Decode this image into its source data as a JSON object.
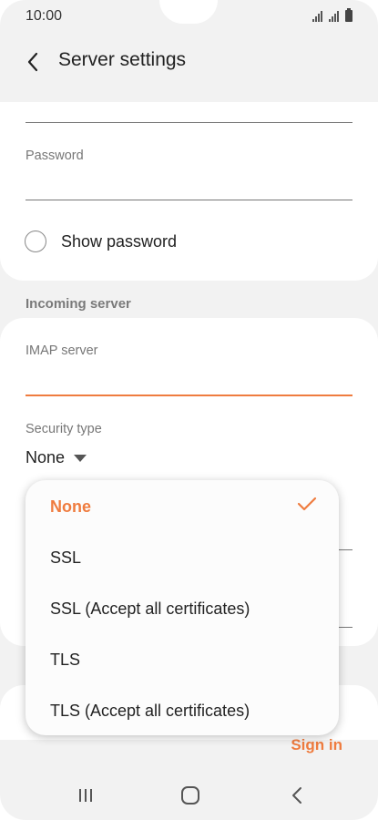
{
  "status_bar": {
    "time": "10:00"
  },
  "app_bar": {
    "title": "Server settings"
  },
  "account": {
    "password_label": "Password",
    "show_password_label": "Show password"
  },
  "incoming_server": {
    "section_title": "Incoming server",
    "imap_server_label": "IMAP server",
    "security_type_label": "Security type",
    "security_type_value": "None"
  },
  "security_dropdown": {
    "options": [
      {
        "label": "None",
        "selected": true
      },
      {
        "label": "SSL",
        "selected": false
      },
      {
        "label": "SSL (Accept all certificates)",
        "selected": false
      },
      {
        "label": "TLS",
        "selected": false
      },
      {
        "label": "TLS (Accept all certificates)",
        "selected": false
      }
    ]
  },
  "footer": {
    "sign_in_label": "Sign in"
  },
  "nav_bar": {
    "icons": [
      "recents-icon",
      "home-icon",
      "back-icon"
    ]
  },
  "colors": {
    "accent": "#ef7c3f",
    "background": "#f2f2f2"
  }
}
